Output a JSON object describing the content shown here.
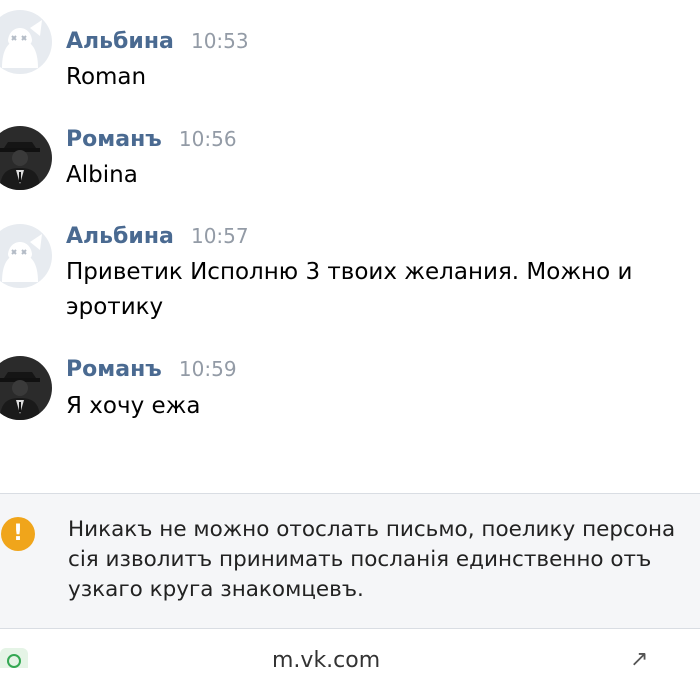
{
  "messages": [
    {
      "author": "Альбина",
      "time": "10:53",
      "text": "Roman",
      "avatar": "dog-avatar-icon"
    },
    {
      "author": "Романъ",
      "time": "10:56",
      "text": "Albina",
      "avatar": "user-photo-avatar"
    },
    {
      "author": "Альбина",
      "time": "10:57",
      "text": "Приветик Исполню 3 твоих желания. Можно и эротику",
      "avatar": "dog-avatar-icon"
    },
    {
      "author": "Романъ",
      "time": "10:59",
      "text": "Я хочу ежа",
      "avatar": "user-photo-avatar"
    }
  ],
  "notice": {
    "icon": "exclamation-icon",
    "icon_glyph": "!",
    "text": "Никакъ не можно отослать письмо, поелику персона сія изволитъ принимать посланія единственно отъ узкаго круга знакомцевъ."
  },
  "browser": {
    "url": "m.vk.com",
    "colors": {
      "author": "#4a6a91",
      "time": "#939ba6",
      "warning": "#f0a51b"
    }
  }
}
